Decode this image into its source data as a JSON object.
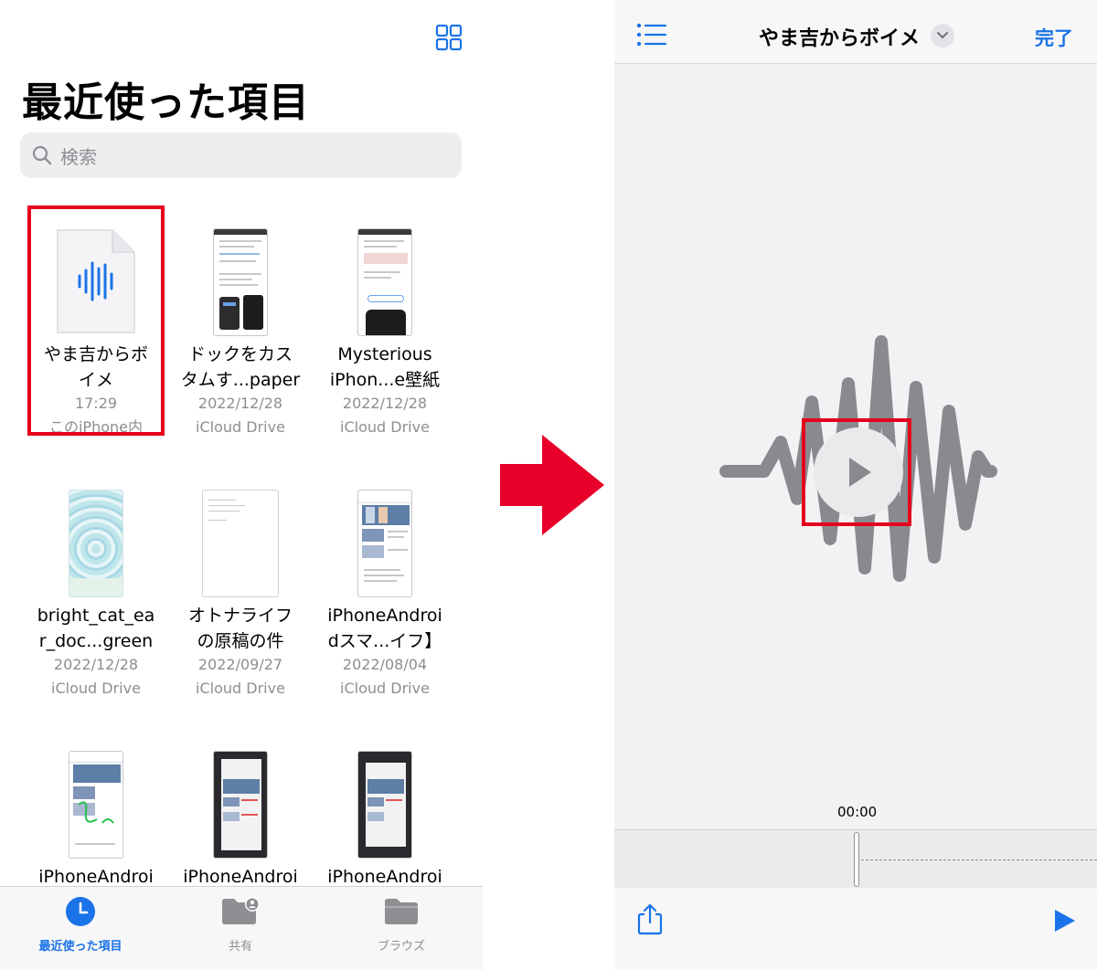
{
  "files_app": {
    "title": "最近使った項目",
    "search_placeholder": "検索",
    "files": [
      {
        "name": "やま吉からボ\nイメ",
        "meta1": "17:29",
        "meta2": "このiPhone内",
        "icon": "waveform-icon"
      },
      {
        "name": "ドックをカス\nタムす...paper",
        "meta1": "2022/12/28",
        "meta2": "iCloud Drive"
      },
      {
        "name": "Mysterious\niPhon...e壁紙",
        "meta1": "2022/12/28",
        "meta2": "iCloud Drive"
      },
      {
        "name": "bright_cat_ea\nr_doc...green",
        "meta1": "2022/12/28",
        "meta2": "iCloud Drive"
      },
      {
        "name": "オトナライフ\nの原稿の件",
        "meta1": "2022/09/27",
        "meta2": "iCloud Drive"
      },
      {
        "name": "iPhoneAndroi\ndスマ...イフ】",
        "meta1": "2022/08/04",
        "meta2": "iCloud Drive"
      },
      {
        "name": "iPhoneAndroi",
        "meta1": "",
        "meta2": ""
      },
      {
        "name": "iPhoneAndroi",
        "meta1": "",
        "meta2": ""
      },
      {
        "name": "iPhoneAndroi",
        "meta1": "",
        "meta2": ""
      }
    ],
    "tabs": [
      {
        "label": "最近使った項目",
        "icon": "clock-icon",
        "active": true
      },
      {
        "label": "共有",
        "icon": "shared-folder-icon",
        "active": false
      },
      {
        "label": "ブラウズ",
        "icon": "folder-icon",
        "active": false
      }
    ]
  },
  "player": {
    "title": "やま吉からボイメ",
    "done_label": "完了",
    "time": "00:00"
  },
  "colors": {
    "accent": "#1a73e8",
    "highlight": "#e5001c",
    "arrow": "#e8002a"
  }
}
